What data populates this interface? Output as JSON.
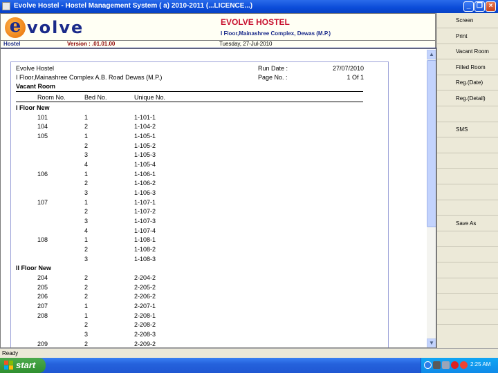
{
  "window": {
    "title": "Evolve Hostel - Hostel Management System ( a) 2010-2011 (...LICENCE...)",
    "minimize": "_",
    "restore": "❐",
    "close": "×"
  },
  "header": {
    "logo_first": "e",
    "logo_rest": "volve",
    "hotel_name": "EVOLVE HOSTEL",
    "hotel_address": "I Floor,Mainashree Complex, Dewas (M.P.)",
    "module": "Hostel",
    "version": "Version : .01.01.00",
    "date": "Tuesday, 27-Jul-2010"
  },
  "report": {
    "company": "Evolve Hostel",
    "address": "I Floor,Mainashree Complex A.B. Road Dewas (M.P.)",
    "title": "Vacant Room",
    "run_date_label": "Run Date :",
    "run_date": "27/07/2010",
    "page_label": "Page No. :",
    "page_value": "1 Of 1",
    "columns": [
      "Room No.",
      "Bed No.",
      "Unique No."
    ],
    "rows": [
      {
        "type": "group",
        "label": "I Floor New"
      },
      {
        "type": "row",
        "room": "101",
        "bed": "1",
        "unique": "1-101-1"
      },
      {
        "type": "row",
        "room": "104",
        "bed": "2",
        "unique": "1-104-2"
      },
      {
        "type": "row",
        "room": "105",
        "bed": "1",
        "unique": "1-105-1"
      },
      {
        "type": "row",
        "room": "",
        "bed": "2",
        "unique": "1-105-2"
      },
      {
        "type": "row",
        "room": "",
        "bed": "3",
        "unique": "1-105-3"
      },
      {
        "type": "row",
        "room": "",
        "bed": "4",
        "unique": "1-105-4"
      },
      {
        "type": "row",
        "room": "106",
        "bed": "1",
        "unique": "1-106-1"
      },
      {
        "type": "row",
        "room": "",
        "bed": "2",
        "unique": "1-106-2"
      },
      {
        "type": "row",
        "room": "",
        "bed": "3",
        "unique": "1-106-3"
      },
      {
        "type": "row",
        "room": "107",
        "bed": "1",
        "unique": "1-107-1"
      },
      {
        "type": "row",
        "room": "",
        "bed": "2",
        "unique": "1-107-2"
      },
      {
        "type": "row",
        "room": "",
        "bed": "3",
        "unique": "1-107-3"
      },
      {
        "type": "row",
        "room": "",
        "bed": "4",
        "unique": "1-107-4"
      },
      {
        "type": "row",
        "room": "108",
        "bed": "1",
        "unique": "1-108-1"
      },
      {
        "type": "row",
        "room": "",
        "bed": "2",
        "unique": "1-108-2"
      },
      {
        "type": "row",
        "room": "",
        "bed": "3",
        "unique": "1-108-3"
      },
      {
        "type": "group",
        "label": "II Floor New"
      },
      {
        "type": "row",
        "room": "204",
        "bed": "2",
        "unique": "2-204-2"
      },
      {
        "type": "row",
        "room": "205",
        "bed": "2",
        "unique": "2-205-2"
      },
      {
        "type": "row",
        "room": "206",
        "bed": "2",
        "unique": "2-206-2"
      },
      {
        "type": "row",
        "room": "207",
        "bed": "1",
        "unique": "2-207-1"
      },
      {
        "type": "row",
        "room": "208",
        "bed": "1",
        "unique": "2-208-1"
      },
      {
        "type": "row",
        "room": "",
        "bed": "2",
        "unique": "2-208-2"
      },
      {
        "type": "row",
        "room": "",
        "bed": "3",
        "unique": "2-208-3"
      },
      {
        "type": "row",
        "room": "209",
        "bed": "2",
        "unique": "2-209-2"
      }
    ]
  },
  "scrollbar": {
    "up": "▲",
    "down": "▼"
  },
  "side_buttons": [
    {
      "label": "Screen"
    },
    {
      "label": "Print"
    },
    {
      "label": "Vacant Room"
    },
    {
      "label": "Filled Room"
    },
    {
      "label": "Reg.(Date)"
    },
    {
      "label": "Reg.(Detail)"
    },
    {
      "label": ""
    },
    {
      "label": "SMS"
    },
    {
      "label": ""
    },
    {
      "label": ""
    },
    {
      "label": ""
    },
    {
      "label": ""
    },
    {
      "label": ""
    },
    {
      "label": "Save As"
    },
    {
      "label": ""
    },
    {
      "label": ""
    },
    {
      "label": ""
    },
    {
      "label": ""
    },
    {
      "label": ""
    },
    {
      "label": ""
    }
  ],
  "status": {
    "text": "Ready"
  },
  "taskbar": {
    "start_label": "start",
    "clock": "2:25 AM"
  },
  "colors": {
    "accent": "#c8102e",
    "brand": "#1a2a8a",
    "taskbar": "#2562dc"
  }
}
